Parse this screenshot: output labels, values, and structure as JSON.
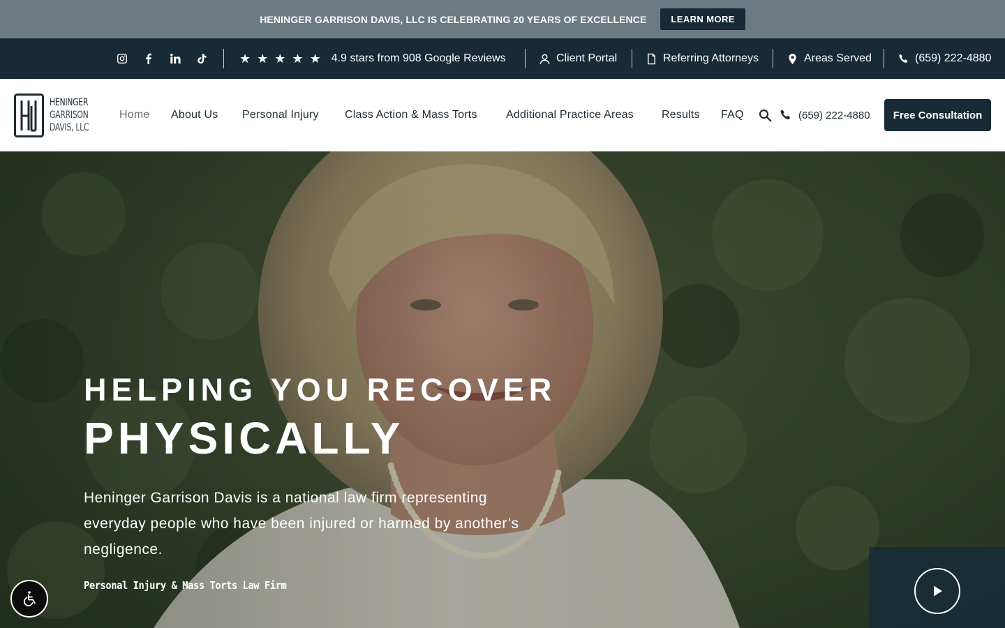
{
  "announcement": {
    "text": "HENINGER GARRISON DAVIS, LLC IS CELEBRATING 20 YEARS OF EXCELLENCE",
    "button_label": "LEARN MORE"
  },
  "utility_bar": {
    "social_icons": [
      "instagram-icon",
      "facebook-icon",
      "linkedin-icon",
      "tiktok-icon"
    ],
    "rating": {
      "stars": 5,
      "text": "4.9 stars from 908 Google Reviews"
    },
    "client_portal": "Client Portal",
    "referring_attorneys": "Referring Attorneys",
    "areas_served": "Areas Served",
    "phone": "(659) 222-4880"
  },
  "header": {
    "logo": {
      "line1": "HENINGER",
      "line2": "GARRISON",
      "line3": "DAVIS, LLC"
    },
    "nav": [
      {
        "label": "Home",
        "active": true
      },
      {
        "label": "About Us",
        "active": false
      },
      {
        "label": "Personal Injury",
        "active": false
      },
      {
        "label": "Class Action & Mass Torts",
        "active": false
      },
      {
        "label": "Additional Practice Areas",
        "active": false
      },
      {
        "label": "Results",
        "active": false
      },
      {
        "label": "FAQ",
        "active": false
      }
    ],
    "phone": "(659) 222-4880",
    "cta_label": "Free Consultation"
  },
  "hero": {
    "headline_line1": "HELPING YOU RECOVER",
    "headline_line2": "PHYSICALLY",
    "description": "Heninger Garrison Davis is a national law firm representing everyday people who have been injured or harmed by another’s negligence.",
    "tagline": "Personal Injury & Mass Torts Law Firm"
  },
  "colors": {
    "navy": "#172a35",
    "announcement_bg": "#6c7a82",
    "white": "#ffffff"
  }
}
